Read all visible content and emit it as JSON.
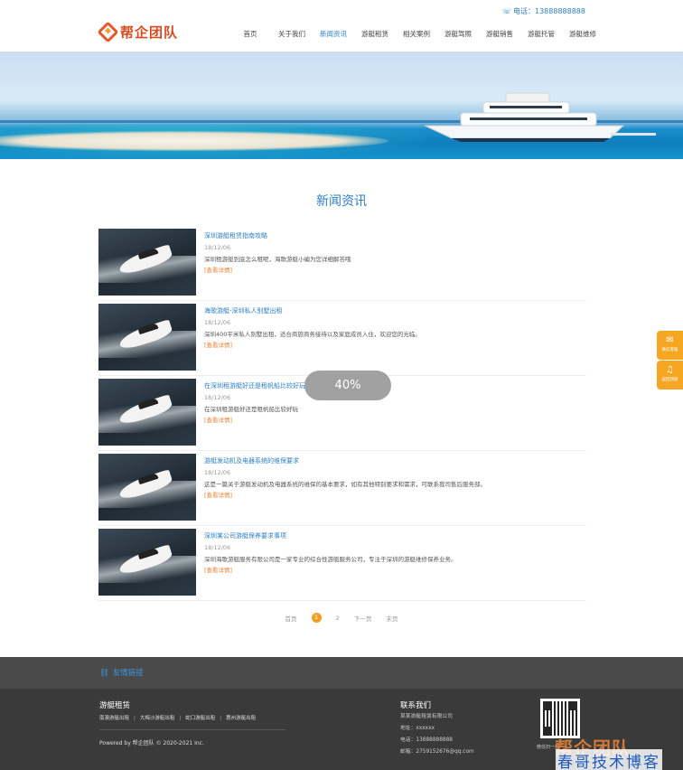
{
  "header": {
    "phone": "电话：13888888888",
    "logo_text": "帮企团队",
    "nav": [
      {
        "label": "首页",
        "active": false
      },
      {
        "label": "关于我们",
        "active": false
      },
      {
        "label": "新闻资讯",
        "active": true
      },
      {
        "label": "游艇租赁",
        "active": false
      },
      {
        "label": "相关案例",
        "active": false
      },
      {
        "label": "游艇驾照",
        "active": false
      },
      {
        "label": "游艇销售",
        "active": false
      },
      {
        "label": "游艇托管",
        "active": false
      },
      {
        "label": "游艇维修",
        "active": false
      }
    ]
  },
  "section_title": "新闻资讯",
  "news": [
    {
      "title": "深圳游艇租赁指南攻略",
      "date": "18/12/06",
      "summary": "深圳租游艇到底怎么租呢，海歌游艇小编为您详细解答哦",
      "more": "[查看详情]"
    },
    {
      "title": "海歌游艇-深圳私人别墅出租",
      "date": "18/12/06",
      "summary": "深圳400平米私人别墅出租，适合商旅商务接待以及家庭成员入住，欢迎您的光临。",
      "more": "[查看详情]"
    },
    {
      "title": "在深圳租游艇好还是租帆船比较好玩",
      "date": "18/12/06",
      "summary": "在深圳租游艇好还是租帆船比较好玩",
      "more": "[查看详情]"
    },
    {
      "title": "游艇发动机及电器系统的维保要求",
      "date": "18/12/06",
      "summary": "这是一篇关于游艇发动机及电器系统的维保的基本要求，如有其他特别要求和需求，可联系我司售后服务部。",
      "more": "[查看详情]"
    },
    {
      "title": "深圳某公司游艇保养要求事项",
      "date": "18/12/06",
      "summary": "深圳海歌游艇服务有限公司是一家专业的综合性游艇服务公司，专注于深圳的游艇维修保养业务。",
      "more": "[查看详情]"
    }
  ],
  "pager": {
    "first": "首页",
    "current": "1",
    "next_num": "2",
    "next": "下一页",
    "last": "末页"
  },
  "loading": "40%",
  "float": {
    "wechat": "微信客服",
    "notify": "返回顶部"
  },
  "footer": {
    "links_title": "友情链接",
    "rental_title": "游艇租赁",
    "rental_links": [
      "南澳游艇出租",
      "大梅沙游艇出租",
      "蛇口游艇出租",
      "惠州游艇出租"
    ],
    "copyright": "Powered by 帮企团队 © 2020-2021 Inc.",
    "contact_title": "联系我们",
    "contact_lines": [
      "某某游艇租赁有限公司",
      "地址：xxxxxx",
      "电话：13888888888",
      "邮箱：2759152676@qq.com"
    ],
    "qr_caption": "微信扫一扫",
    "watermark_logo": "帮企团队",
    "watermark_text": "春哥技术博客"
  },
  "colors": {
    "accent": "#2e7fc4",
    "orange": "#f5a623",
    "footer_bg": "#3a3a3a"
  }
}
